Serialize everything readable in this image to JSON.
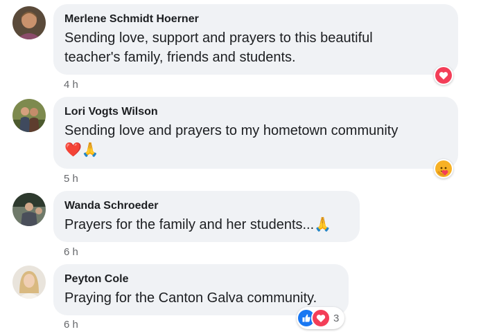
{
  "comments": [
    {
      "author": "Merlene Schmidt Hoerner",
      "text_lines": [
        "Sending love, support and prayers to this beautiful",
        "teacher's family, friends and students."
      ],
      "time": "4 h",
      "reactions": [
        "love-icon"
      ]
    },
    {
      "author": "Lori Vogts Wilson",
      "text_lines": [
        "Sending love and prayers to my hometown community",
        "❤️🙏"
      ],
      "time": "5 h",
      "reactions": [
        "care-icon"
      ]
    },
    {
      "author": "Wanda Schroeder",
      "text_lines": [
        "Prayers for the family and her students...🙏"
      ],
      "time": "6 h",
      "reactions": []
    },
    {
      "author": "Peyton Cole",
      "text_lines": [
        "Praying for the Canton Galva community."
      ],
      "time": "6 h",
      "reactions": [
        "like-icon",
        "love-icon"
      ],
      "reaction_count": "3"
    }
  ],
  "colors": {
    "bubble_bg": "#f0f2f5",
    "like_blue": "#1877f2",
    "love_red": "#f33e58",
    "care_yellow": "#f7b125",
    "meta_gray": "#65676b"
  }
}
